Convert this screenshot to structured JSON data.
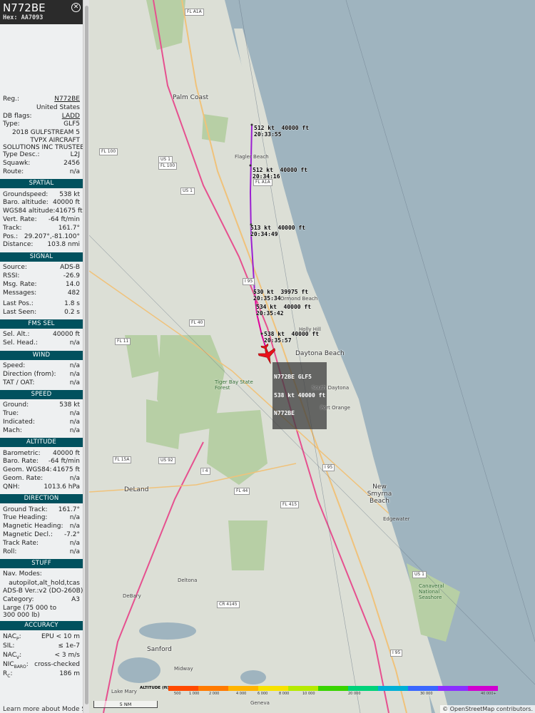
{
  "header": {
    "callsign": "N772BE",
    "hex_label": "Hex:",
    "hex": "AA7093"
  },
  "info": {
    "reg_label": "Reg.:",
    "reg": "N772BE",
    "country": "United States",
    "dbflags_label": "DB flags:",
    "dbflags": "LADD",
    "type_label": "Type:",
    "type": "GLF5",
    "model": "2018 GULFSTREAM 5",
    "owner1": "TVPX AIRCRAFT",
    "owner2": "SOLUTIONS INC TRUSTEE",
    "typedesc_label": "Type Desc.:",
    "typedesc": "L2J",
    "squawk_label": "Squawk:",
    "squawk": "2456",
    "route_label": "Route:",
    "route": "n/a"
  },
  "spatial": {
    "title": "SPATIAL",
    "rows": [
      {
        "k": "Groundspeed:",
        "v": "538 kt"
      },
      {
        "k": "Baro. altitude:",
        "v": "40000 ft"
      },
      {
        "k": "WGS84 altitude:",
        "v": "41675 ft"
      },
      {
        "k": "Vert. Rate:",
        "v": "-64 ft/min"
      },
      {
        "k": "Track:",
        "v": "161.7°"
      },
      {
        "k": "Pos.:",
        "v": "29.207°,-81.100°"
      },
      {
        "k": "Distance:",
        "v": "103.8 nmi"
      }
    ]
  },
  "signal": {
    "title": "SIGNAL",
    "rows": [
      {
        "k": "Source:",
        "v": "ADS-B"
      },
      {
        "k": "RSSI:",
        "v": "-26.9"
      },
      {
        "k": "Msg. Rate:",
        "v": "14.0"
      },
      {
        "k": "Messages:",
        "v": "482"
      }
    ],
    "rows2": [
      {
        "k": "Last Pos.:",
        "v": "1.8 s"
      },
      {
        "k": "Last Seen:",
        "v": "0.2 s"
      }
    ]
  },
  "fms": {
    "title": "FMS SEL",
    "rows": [
      {
        "k": "Sel. Alt.:",
        "v": "40000 ft"
      },
      {
        "k": "Sel. Head.:",
        "v": "n/a"
      }
    ]
  },
  "wind": {
    "title": "WIND",
    "rows": [
      {
        "k": "Speed:",
        "v": "n/a"
      },
      {
        "k": "Direction (from):",
        "v": "n/a"
      },
      {
        "k": "TAT / OAT:",
        "v": "n/a"
      }
    ]
  },
  "speed": {
    "title": "SPEED",
    "rows": [
      {
        "k": "Ground:",
        "v": "538 kt"
      },
      {
        "k": "True:",
        "v": "n/a"
      },
      {
        "k": "Indicated:",
        "v": "n/a"
      },
      {
        "k": "Mach:",
        "v": "n/a"
      }
    ]
  },
  "altitude": {
    "title": "ALTITUDE",
    "rows": [
      {
        "k": "Barometric:",
        "v": "40000 ft"
      },
      {
        "k": "Baro. Rate:",
        "v": "-64 ft/min"
      },
      {
        "k": "Geom. WGS84:",
        "v": "41675 ft"
      },
      {
        "k": "Geom. Rate:",
        "v": "n/a"
      },
      {
        "k": "QNH:",
        "v": "1013.6 hPa"
      }
    ]
  },
  "direction": {
    "title": "DIRECTION",
    "rows": [
      {
        "k": "Ground Track:",
        "v": "161.7°"
      },
      {
        "k": "True Heading:",
        "v": "n/a"
      },
      {
        "k": "Magnetic Heading:",
        "v": "n/a"
      },
      {
        "k": "Magnetic Decl.:",
        "v": "-7.2°"
      },
      {
        "k": "Track Rate:",
        "v": "n/a"
      },
      {
        "k": "Roll:",
        "v": "n/a"
      }
    ]
  },
  "stuff": {
    "title": "STUFF",
    "navmodes_label": "Nav. Modes:",
    "navmodes": "autopilot,alt_hold,tcas",
    "adsb_label": "ADS-B Ver.:",
    "adsb": "v2 (DO-260B)",
    "category_label": "Category:",
    "category": "A3",
    "cat_desc1": "Large (75 000 to",
    "cat_desc2": "300 000 lb)"
  },
  "accuracy": {
    "title": "ACCURACY",
    "nacp_label": "NAC",
    "nacp_sub": "P",
    "nacp": "EPU < 10 m",
    "sil_label": "SIL:",
    "sil": "≤ 1e-7",
    "nacv_label": "NAC",
    "nacv_sub": "V",
    "nacv": "< 3 m/s",
    "nicbaro_label": "NIC",
    "nicbaro_sub": "BARO",
    "nicbaro": "cross-checked",
    "rc_label": "R",
    "rc_sub": "C",
    "rc": "186 m"
  },
  "footer": {
    "learn_more": "Learn more about Mode S"
  },
  "map": {
    "track_labels": [
      {
        "l1": "512 kt  40000 ft",
        "l2": "20:33:55"
      },
      {
        "l1": "512 kt  40000 ft",
        "l2": "20:34:16"
      },
      {
        "l1": "513 kt  40000 ft",
        "l2": "20:34:49"
      },
      {
        "l1": "530 kt  39975 ft",
        "l2": "20:35:34"
      },
      {
        "l1": "534 kt  40000 ft",
        "l2": "20:35:42"
      },
      {
        "l1": "538 kt  40000 ft",
        "l2": "20:35:57"
      }
    ],
    "aircraft_label": {
      "l1": "N772BE GLF5",
      "l2": "538 kt 40000 ft",
      "l3": "N772BE"
    },
    "places": {
      "palm_coast": "Palm Coast",
      "flagler_beach": "Flagler Beach",
      "ormond_beach": "Ormond Beach",
      "holly_hill": "Holly Hill",
      "daytona_beach": "Daytona Beach",
      "south_daytona": "South Daytona",
      "port_orange": "Port Orange",
      "new_smyrna_beach": "New Smyrna Beach",
      "edgewater": "Edgewater",
      "deland": "DeLand",
      "deltona": "Deltona",
      "debary": "DeBary",
      "sanford": "Sanford",
      "lake_mary": "Lake Mary",
      "midway": "Midway",
      "geneva": "Geneva",
      "tiger_bay": "Tiger Bay State Forest",
      "canaveral": "Canaveral National Seashore"
    },
    "shields": {
      "fl1a_top": "FL A1A",
      "fl100": "FL 100",
      "us1_a": "US 1",
      "fl100b": "FL 100",
      "us1_b": "US 1",
      "fl1a_mid": "FL A1A",
      "i95": "I 95",
      "fl40": "FL 40",
      "fl11": "FL 11",
      "us92": "US 92",
      "i4": "I 4",
      "fl15a": "FL 15A",
      "fl44": "FL 44",
      "fl415": "FL 415",
      "i95b": "I 95",
      "us1_c": "US 1",
      "cr4145": "CR 4145",
      "i95c": "I 95"
    },
    "scale_label": "5 NM",
    "attribution": "© OpenStreetMap contributors.",
    "altitude_legend": {
      "title": "ALTITUDE (ft)",
      "ticks": [
        "500",
        "1 000",
        "2 000",
        "4 000",
        "6 000",
        "8 000",
        "10 000",
        "20 000",
        "30 000",
        "40 000+"
      ],
      "colors": [
        "#ff4900",
        "#ff7a00",
        "#ffb400",
        "#f7e200",
        "#b6ea00",
        "#39d400",
        "#00d27a",
        "#00b0d6",
        "#3a67ff",
        "#8b2fff",
        "#d000d0"
      ]
    },
    "colors": {
      "ocean": "#9fb4bf",
      "land": "#dcdfd6",
      "park": "#b7cfa5",
      "track_purple": "#9b1fd1",
      "track_magenta": "#e0009a",
      "aircraft": "#e8101a",
      "highway": "#e6508f",
      "road": "#f0c27a"
    }
  }
}
